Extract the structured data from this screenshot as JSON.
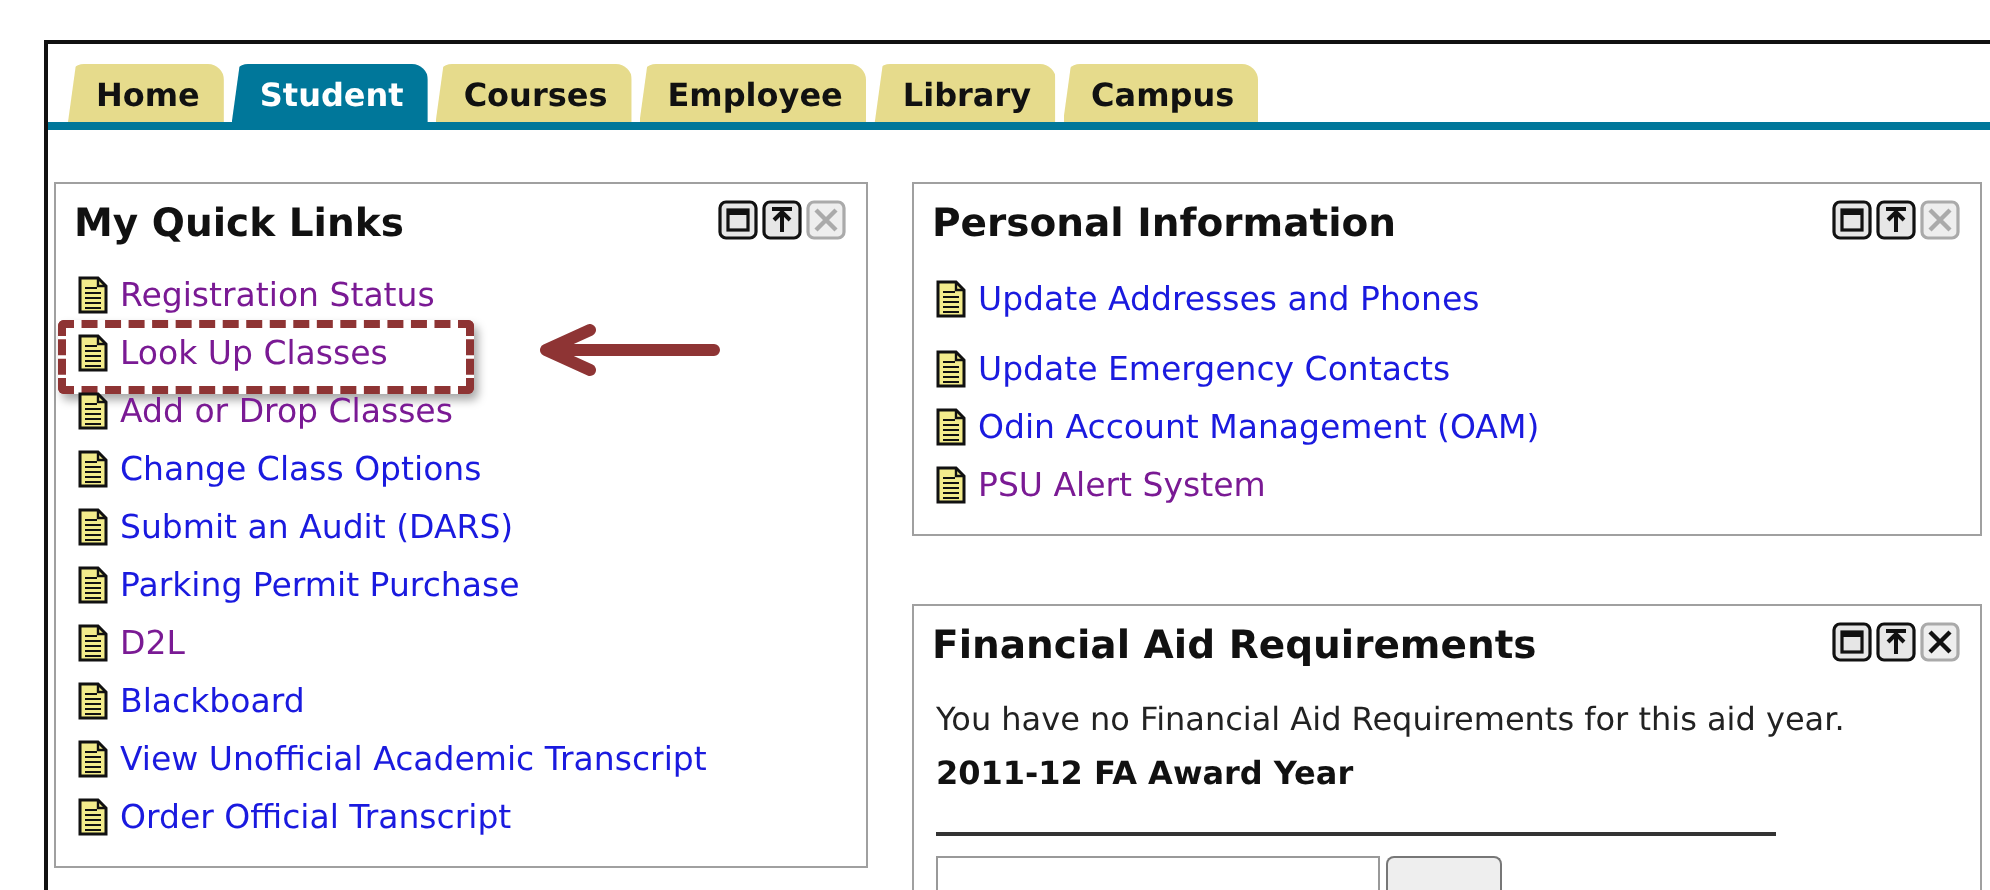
{
  "tabs": [
    {
      "label": "Home",
      "selected": false
    },
    {
      "label": "Student",
      "selected": true
    },
    {
      "label": "Courses",
      "selected": false
    },
    {
      "label": "Employee",
      "selected": false
    },
    {
      "label": "Library",
      "selected": false
    },
    {
      "label": "Campus",
      "selected": false
    }
  ],
  "quick_links": {
    "title": "My Quick Links",
    "close_disabled": true,
    "links": [
      {
        "label": "Registration Status",
        "visited": true,
        "highlighted": false
      },
      {
        "label": "Look Up Classes",
        "visited": true,
        "highlighted": true
      },
      {
        "label": "Add or Drop Classes",
        "visited": true,
        "highlighted": false
      },
      {
        "label": "Change Class Options",
        "visited": false,
        "highlighted": false
      },
      {
        "label": "Submit an Audit (DARS)",
        "visited": false,
        "highlighted": false
      },
      {
        "label": "Parking Permit Purchase",
        "visited": false,
        "highlighted": false
      },
      {
        "label": "D2L",
        "visited": true,
        "highlighted": false
      },
      {
        "label": "Blackboard",
        "visited": false,
        "highlighted": false
      },
      {
        "label": "View Unofficial Academic Transcript",
        "visited": false,
        "highlighted": false
      },
      {
        "label": "Order Official Transcript",
        "visited": false,
        "highlighted": false
      }
    ]
  },
  "personal_information": {
    "title": "Personal Information",
    "close_disabled": true,
    "links": [
      {
        "label": "Update Addresses and Phones",
        "visited": false
      },
      {
        "label": "Update Emergency Contacts",
        "visited": false
      },
      {
        "label": "Odin Account Management (OAM)",
        "visited": false
      },
      {
        "label": "PSU Alert System",
        "visited": true
      }
    ]
  },
  "financial_aid": {
    "title": "Financial Aid Requirements",
    "close_disabled": false,
    "message": "You have no Financial Aid Requirements for this aid year.",
    "award_year": "2011-12 FA Award Year"
  }
}
